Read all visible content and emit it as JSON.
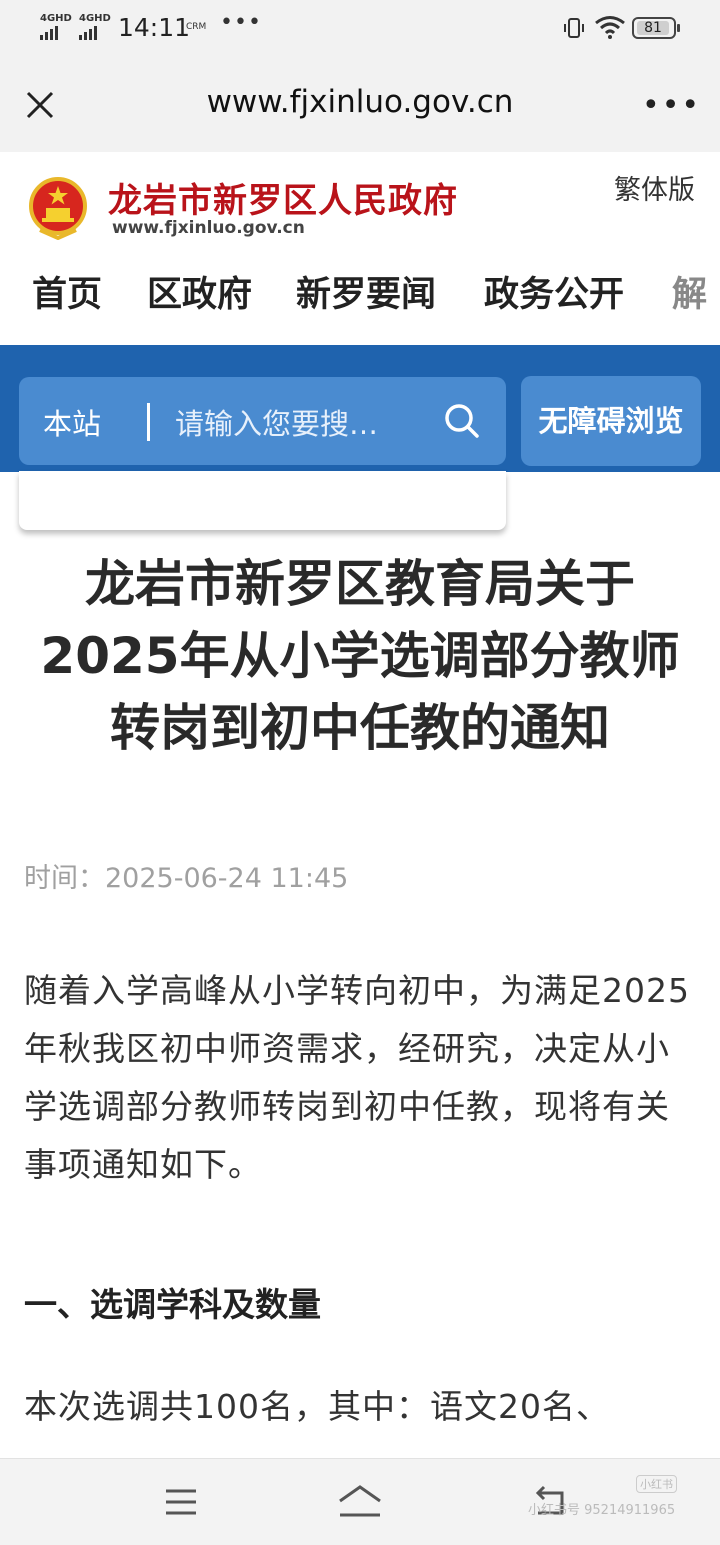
{
  "status_bar": {
    "signal1": "4GHD",
    "signal2": "4GHD",
    "time": "14:11",
    "crm": "CRM",
    "dots": "•••",
    "battery": "81"
  },
  "browser": {
    "url": "www.fjxinluo.gov.cn",
    "more": "•••"
  },
  "site": {
    "title": "龙岩市新罗区人民政府",
    "url": "www.fjxinluo.gov.cn",
    "traditional_link": "繁体版",
    "nav": [
      "首页",
      "区政府",
      "新罗要闻",
      "政务公开",
      "解"
    ]
  },
  "search": {
    "scope": "本站",
    "placeholder": "请输入您要搜…",
    "accessibility_button": "无障碍浏览"
  },
  "article": {
    "title": "龙岩市新罗区教育局关于2025年从小学选调部分教师转岗到初中任教的通知",
    "time_label": "时间：",
    "time_value": "2025-06-24 11:45",
    "paragraph1": "随着入学高峰从小学转向初中，为满足2025年秋我区初中师资需求，经研究，决定从小学选调部分教师转岗到初中任教，现将有关事项通知如下。",
    "section1_heading": "一、选调学科及数量",
    "paragraph2": "本次选调共100名，其中：语文20名、"
  },
  "watermark": {
    "logo": "小红书",
    "text": "小红书号 95214911965"
  }
}
